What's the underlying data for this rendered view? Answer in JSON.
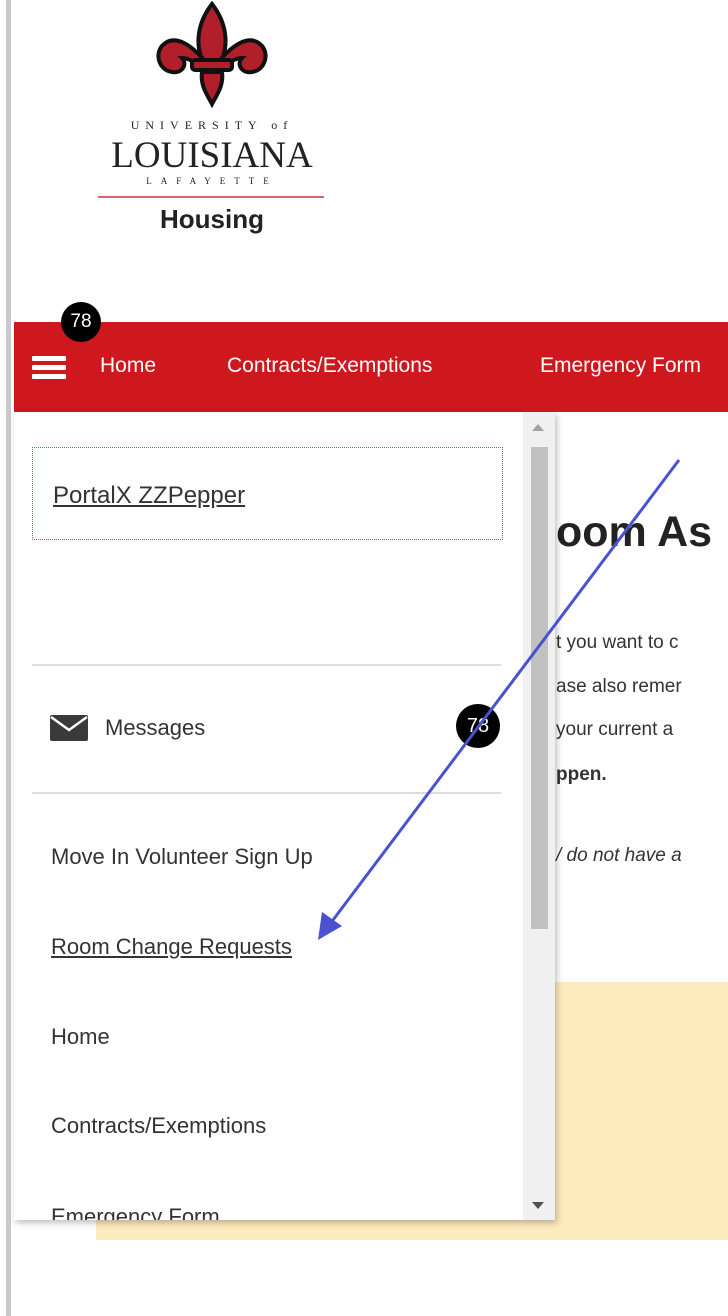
{
  "logo": {
    "university_line": "UNIVERSITY of",
    "name_line": "LOUISIANA",
    "campus_line": "LAFAYETTE",
    "department": "Housing"
  },
  "navbar": {
    "badge_count": "78",
    "menu_icon": "hamburger-menu-icon",
    "links": [
      "Home",
      "Contracts/Exemptions",
      "Emergency Form"
    ]
  },
  "drawer": {
    "user_name": "PortalX ZZPepper",
    "messages_label": "Messages",
    "messages_badge": "78",
    "messages_icon": "envelope-icon",
    "items": [
      "Move In Volunteer Sign Up",
      "Room Change Requests",
      "Home",
      "Contracts/Exemptions",
      "Emergency Form"
    ]
  },
  "content": {
    "title_fragment": "oom As",
    "line1": "t you want to c",
    "line2": "ase also remer",
    "line3": "your current a",
    "line4": "ppen.",
    "line5": "/ do not have a"
  },
  "colors": {
    "navbar": "#ce181e",
    "badge": "#000000",
    "notice_box": "#fdebbd",
    "annotation_arrow": "#4a52d0"
  }
}
